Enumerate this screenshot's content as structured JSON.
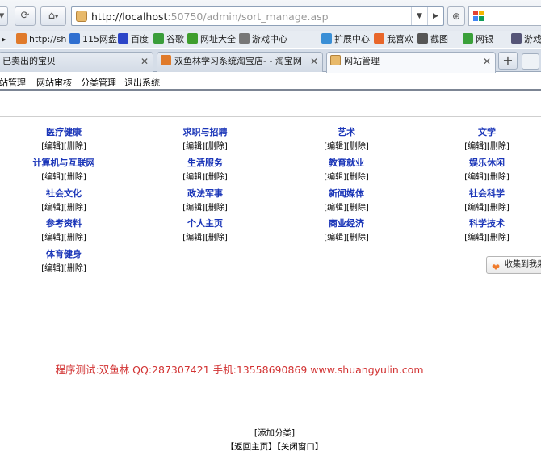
{
  "browser": {
    "url_host": "http://localhost",
    "url_rest": ":50750/admin/sort_manage.asp",
    "bookmarks": [
      {
        "label": "http://sh",
        "icon": "bookmark-icon-sh",
        "color": "#e07a2a"
      },
      {
        "label": "115网盘",
        "icon": "cloud-icon",
        "color": "#2f6fd0"
      },
      {
        "label": "百度",
        "icon": "baidu-paw-icon",
        "color": "#2c45c8"
      },
      {
        "label": "谷歌",
        "icon": "google-icon",
        "color": "#3a9d3a"
      },
      {
        "label": "网址大全",
        "icon": "compass-icon",
        "color": "#3f9e2d"
      },
      {
        "label": "游戏中心",
        "icon": "gamepad-icon",
        "color": "#777777"
      },
      {
        "label": "扩展中心",
        "icon": "puzzle-icon",
        "color": "#3a8fd6"
      },
      {
        "label": "我喜欢",
        "icon": "heart-icon",
        "color": "#e8662a"
      },
      {
        "label": "截图",
        "icon": "scissors-icon",
        "color": "#555555"
      },
      {
        "label": "网银",
        "icon": "bank-icon",
        "color": "#3aa03a"
      },
      {
        "label": "游戏",
        "icon": "game-icon",
        "color": "#557"
      }
    ],
    "tabs": [
      {
        "label": "已卖出的宝贝",
        "active": false
      },
      {
        "label": "双鱼林学习系统淘宝店- - 淘宝网",
        "active": false
      },
      {
        "label": "网站管理",
        "active": true
      }
    ],
    "new_tab_symbol": "+"
  },
  "menu": {
    "items": [
      "站管理",
      "网站审核",
      "分类管理",
      "退出系统"
    ]
  },
  "categories": [
    {
      "name": "医疗健康",
      "edit": "[编辑]",
      "del": "[删除]"
    },
    {
      "name": "求职与招聘",
      "edit": "[编辑]",
      "del": "[删除]"
    },
    {
      "name": "艺术",
      "edit": "[编辑]",
      "del": "[删除]"
    },
    {
      "name": "文学",
      "edit": "[编辑]",
      "del": "[删除]"
    },
    {
      "name": "计算机与互联网",
      "edit": "[编辑]",
      "del": "[删除]"
    },
    {
      "name": "生活服务",
      "edit": "[编辑]",
      "del": "[删除]"
    },
    {
      "name": "教育就业",
      "edit": "[编辑]",
      "del": "[删除]"
    },
    {
      "name": "娱乐休闲",
      "edit": "[编辑]",
      "del": "[删除]"
    },
    {
      "name": "社会文化",
      "edit": "[编辑]",
      "del": "[删除]"
    },
    {
      "name": "政法军事",
      "edit": "[编辑]",
      "del": "[删除]"
    },
    {
      "name": "新闻媒体",
      "edit": "[编辑]",
      "del": "[删除]"
    },
    {
      "name": "社会科学",
      "edit": "[编辑]",
      "del": "[删除]"
    },
    {
      "name": "参考资料",
      "edit": "[编辑]",
      "del": "[删除]"
    },
    {
      "name": "个人主页",
      "edit": "[编辑]",
      "del": "[删除]"
    },
    {
      "name": "商业经济",
      "edit": "[编辑]",
      "del": "[删除]"
    },
    {
      "name": "科学技术",
      "edit": "[编辑]",
      "del": "[删除]"
    },
    {
      "name": "体育健身",
      "edit": "[编辑]",
      "del": "[删除]"
    }
  ],
  "credit": "程序测试:双鱼林 QQ:287307421 手机:13558690869 www.shuangyulin.com",
  "add_category": "[添加分类]",
  "back_home": "【返回主页】",
  "close_window": "【关闭窗口】",
  "collect_button": "收集到我果"
}
